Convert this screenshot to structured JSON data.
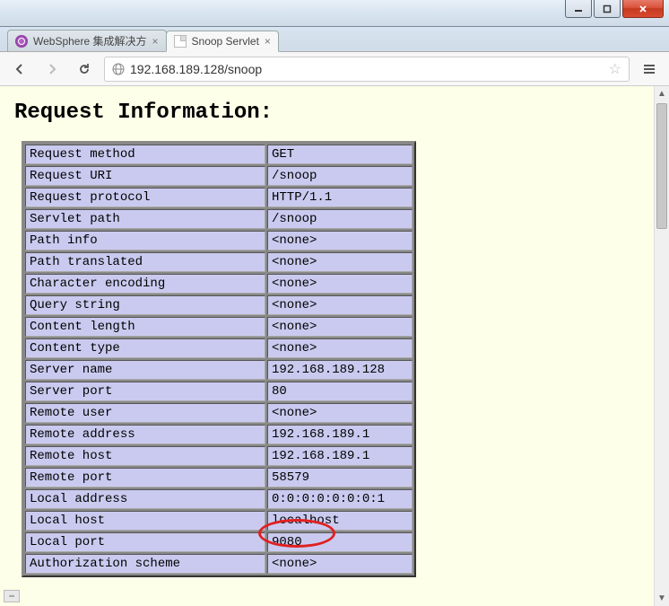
{
  "window": {
    "controls": {
      "min": "minimize",
      "max": "maximize",
      "close": "close"
    }
  },
  "tabs": [
    {
      "title": "WebSphere 集成解决方",
      "active": false
    },
    {
      "title": "Snoop Servlet",
      "active": true
    }
  ],
  "address": "192.168.189.128/snoop",
  "page": {
    "heading": "Request Information:",
    "rows": [
      {
        "k": "Request method",
        "v": "GET"
      },
      {
        "k": "Request URI",
        "v": "/snoop"
      },
      {
        "k": "Request protocol",
        "v": "HTTP/1.1"
      },
      {
        "k": "Servlet path",
        "v": "/snoop"
      },
      {
        "k": "Path info",
        "v": "<none>"
      },
      {
        "k": "Path translated",
        "v": "<none>"
      },
      {
        "k": "Character encoding",
        "v": "<none>"
      },
      {
        "k": "Query string",
        "v": "<none>"
      },
      {
        "k": "Content length",
        "v": "<none>"
      },
      {
        "k": "Content type",
        "v": "<none>"
      },
      {
        "k": "Server name",
        "v": "192.168.189.128"
      },
      {
        "k": "Server port",
        "v": "80"
      },
      {
        "k": "Remote user",
        "v": "<none>"
      },
      {
        "k": "Remote address",
        "v": "192.168.189.1"
      },
      {
        "k": "Remote host",
        "v": "192.168.189.1"
      },
      {
        "k": "Remote port",
        "v": "58579"
      },
      {
        "k": "Local address",
        "v": "0:0:0:0:0:0:0:1"
      },
      {
        "k": "Local host",
        "v": "localhost"
      },
      {
        "k": "Local port",
        "v": "9080"
      },
      {
        "k": "Authorization scheme",
        "v": "<none>"
      }
    ]
  }
}
